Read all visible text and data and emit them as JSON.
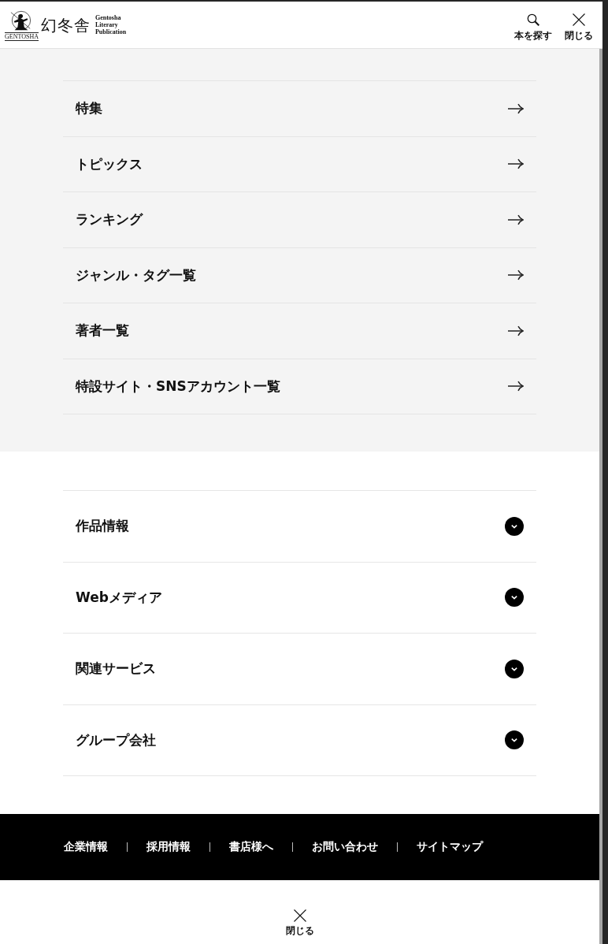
{
  "header": {
    "logo": {
      "mark_text": "GENTOSHA",
      "name": "幻冬舎",
      "tagline": [
        "Gentosha",
        "Literary",
        "Publication"
      ]
    },
    "actions": [
      {
        "kind": "search",
        "label": "本を探す"
      },
      {
        "kind": "close",
        "label": "閉じる"
      }
    ]
  },
  "nav_links": [
    {
      "label": "特集"
    },
    {
      "label": "トピックス"
    },
    {
      "label": "ランキング"
    },
    {
      "label": "ジャンル・タグ一覧"
    },
    {
      "label": "著者一覧"
    },
    {
      "label": "特設サイト・SNSアカウント一覧"
    }
  ],
  "accordions": [
    {
      "label": "作品情報",
      "expanded": false
    },
    {
      "label": "Webメディア",
      "expanded": false
    },
    {
      "label": "関連サービス",
      "expanded": false
    },
    {
      "label": "グループ会社",
      "expanded": false
    }
  ],
  "footer_links": [
    "企業情報",
    "採用情報",
    "書店様へ",
    "お問い合わせ",
    "サイトマップ"
  ],
  "close_button": {
    "label": "閉じる"
  }
}
